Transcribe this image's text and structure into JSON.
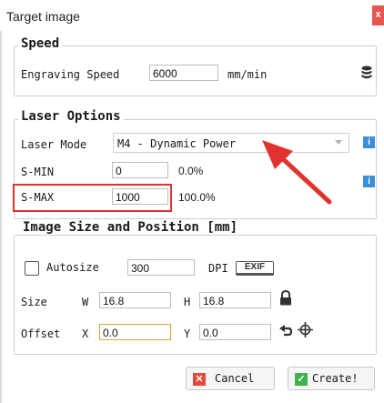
{
  "window": {
    "title": "Target image",
    "close_glyph": "x"
  },
  "speed": {
    "group_title": "Speed",
    "engraving_label": "Engraving Speed",
    "engraving_value": "6000",
    "unit": "mm/min",
    "icon": "database-icon"
  },
  "laser": {
    "group_title": "Laser Options",
    "mode_label": "Laser Mode",
    "mode_value": "M4 - Dynamic Power",
    "smin_label": "S-MIN",
    "smin_value": "0",
    "smin_percent": "0.0%",
    "smax_label": "S-MAX",
    "smax_value": "1000",
    "smax_percent": "100.0%",
    "info_glyph": "i",
    "highlight_color": "#e0332e"
  },
  "image": {
    "group_title": "Image Size and Position [mm]",
    "autosize_label": "Autosize",
    "autosize_checked": false,
    "dpi_value": "300",
    "dpi_label": "DPI",
    "exif_label": "EXIF",
    "size_label": "Size",
    "w_label": "W",
    "w_value": "16.8",
    "h_label": "H",
    "h_value": "16.8",
    "offset_label": "Offset",
    "x_label": "X",
    "x_value": "0.0",
    "y_label": "Y",
    "y_value": "0.0"
  },
  "buttons": {
    "cancel_label": "Cancel",
    "create_label": "Create!"
  }
}
